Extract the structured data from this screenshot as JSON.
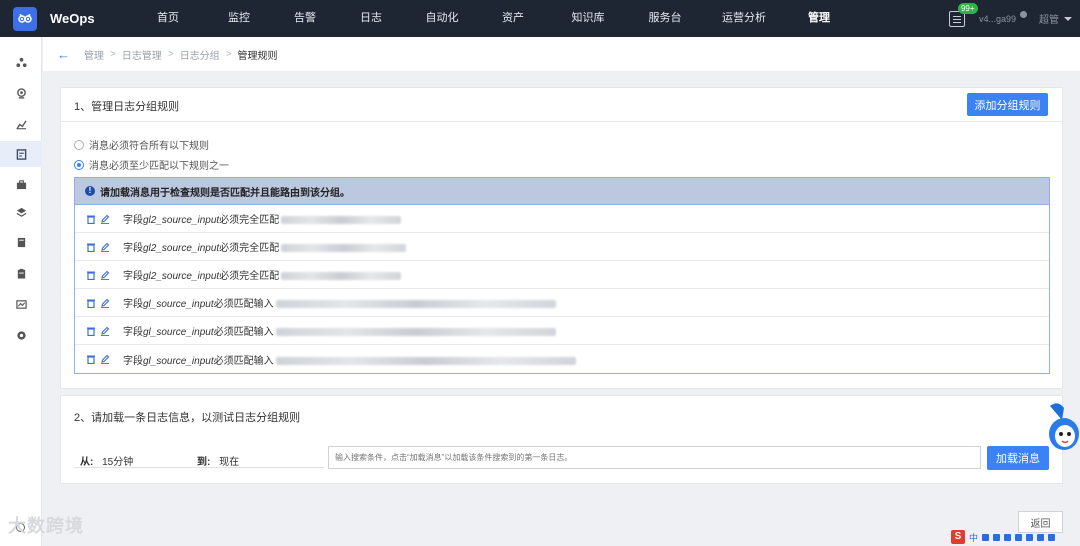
{
  "app": {
    "brand": "WeOps",
    "logo_icon": "owl-logo-icon"
  },
  "topnav": {
    "items": [
      "首页",
      "监控",
      "告警",
      "日志",
      "自动化",
      "资产",
      "知识库",
      "服务台",
      "运营分析",
      "管理"
    ],
    "active": "管理",
    "notification_badge": "99+",
    "version": "v4...ga99",
    "user": "超管"
  },
  "sidebar": {
    "icons": [
      "topology-icon",
      "monitor-icon",
      "chart-icon",
      "log-icon",
      "toolbox-icon",
      "layers-icon",
      "book-icon",
      "clipboard-icon",
      "trend-icon",
      "settings-icon"
    ],
    "active_index": 3
  },
  "breadcrumb": {
    "items": [
      "管理",
      "日志管理",
      "日志分组",
      "管理规则"
    ]
  },
  "section1": {
    "title": "1、管理日志分组规则",
    "add_button": "添加分组规则",
    "radio_all": "消息必须符合所有以下规则",
    "radio_any": "消息必须至少匹配以下规则之一",
    "selected": "any",
    "info_text": "请加载消息用于检查规则是否匹配并且能路由到该分组。",
    "rules": [
      {
        "prefix": "字段",
        "field": "gl2_source_input",
        "op": "必须完全匹配"
      },
      {
        "prefix": "字段",
        "field": "gl2_source_input",
        "op": "必须完全匹配"
      },
      {
        "prefix": "字段",
        "field": "gl2_source_input",
        "op": "必须完全匹配"
      },
      {
        "prefix": "字段",
        "field": "gl_source_input",
        "op": "必须匹配输入"
      },
      {
        "prefix": "字段",
        "field": "gl_source_input",
        "op": "必须匹配输入"
      },
      {
        "prefix": "字段",
        "field": "gl_source_input",
        "op": "必须匹配输入"
      }
    ]
  },
  "section2": {
    "title": "2、请加载一条日志信息，以测试日志分组规则",
    "from_label": "从:",
    "from_value": "15分钟",
    "to_label": "到:",
    "to_value": "现在",
    "search_placeholder": "输入搜索条件，点击“加载消息”以加载该条件搜索到的第一条日志。",
    "load_button": "加载消息"
  },
  "footer": {
    "return_button": "返回",
    "watermark": "大数跨境",
    "ime_label": "中"
  },
  "colors": {
    "primary": "#3b82f6",
    "topbar": "#1f2633",
    "info_bg": "#bcc8e0"
  }
}
